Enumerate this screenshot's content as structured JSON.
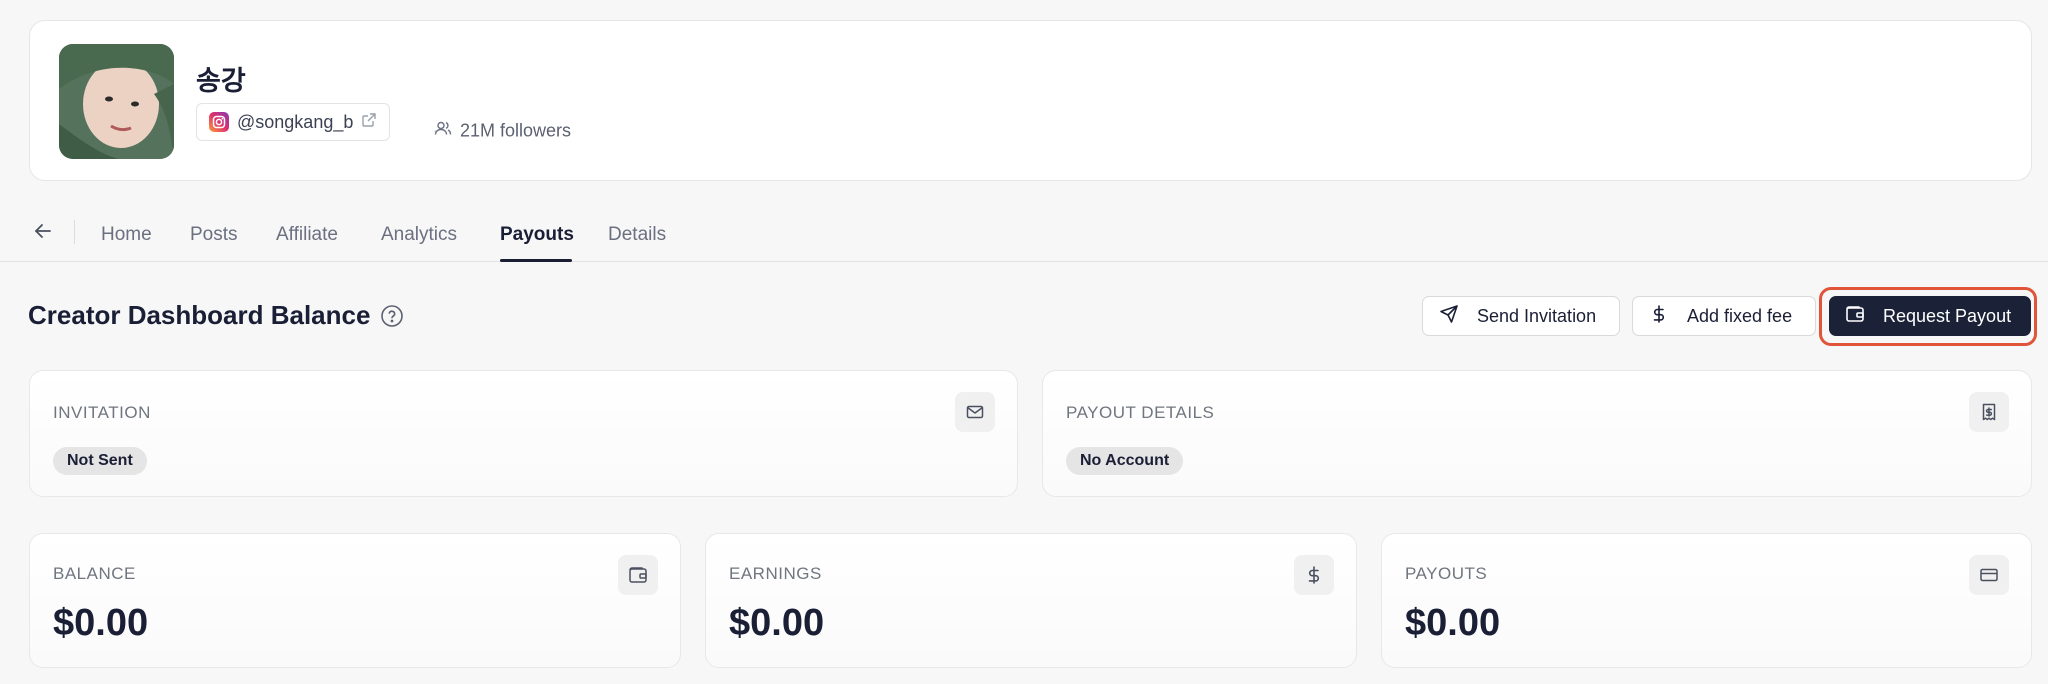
{
  "profile": {
    "name": "송강",
    "handle": "@songkang_b",
    "followers": "21M followers",
    "separator": "·"
  },
  "tabs": [
    {
      "label": "Home"
    },
    {
      "label": "Posts"
    },
    {
      "label": "Affiliate"
    },
    {
      "label": "Analytics"
    },
    {
      "label": "Payouts",
      "active": true
    },
    {
      "label": "Details"
    }
  ],
  "section": {
    "title": "Creator Dashboard Balance"
  },
  "actions": {
    "send_invitation": "Send Invitation",
    "add_fixed_fee": "Add fixed fee",
    "request_payout": "Request Payout"
  },
  "status_cards": {
    "invitation": {
      "label": "INVITATION",
      "badge": "Not Sent",
      "icon": "mail-icon"
    },
    "payout_details": {
      "label": "PAYOUT DETAILS",
      "badge": "No Account",
      "icon": "receipt-dollar-icon"
    }
  },
  "amount_cards": {
    "balance": {
      "label": "BALANCE",
      "value": "$0.00",
      "icon": "wallet-icon"
    },
    "earnings": {
      "label": "EARNINGS",
      "value": "$0.00",
      "icon": "dollar-icon"
    },
    "payouts": {
      "label": "PAYOUTS",
      "value": "$0.00",
      "icon": "credit-card-icon"
    }
  },
  "colors": {
    "primary_dark": "#1b2238",
    "highlight": "#e0543a",
    "background": "#f7f7f7"
  }
}
